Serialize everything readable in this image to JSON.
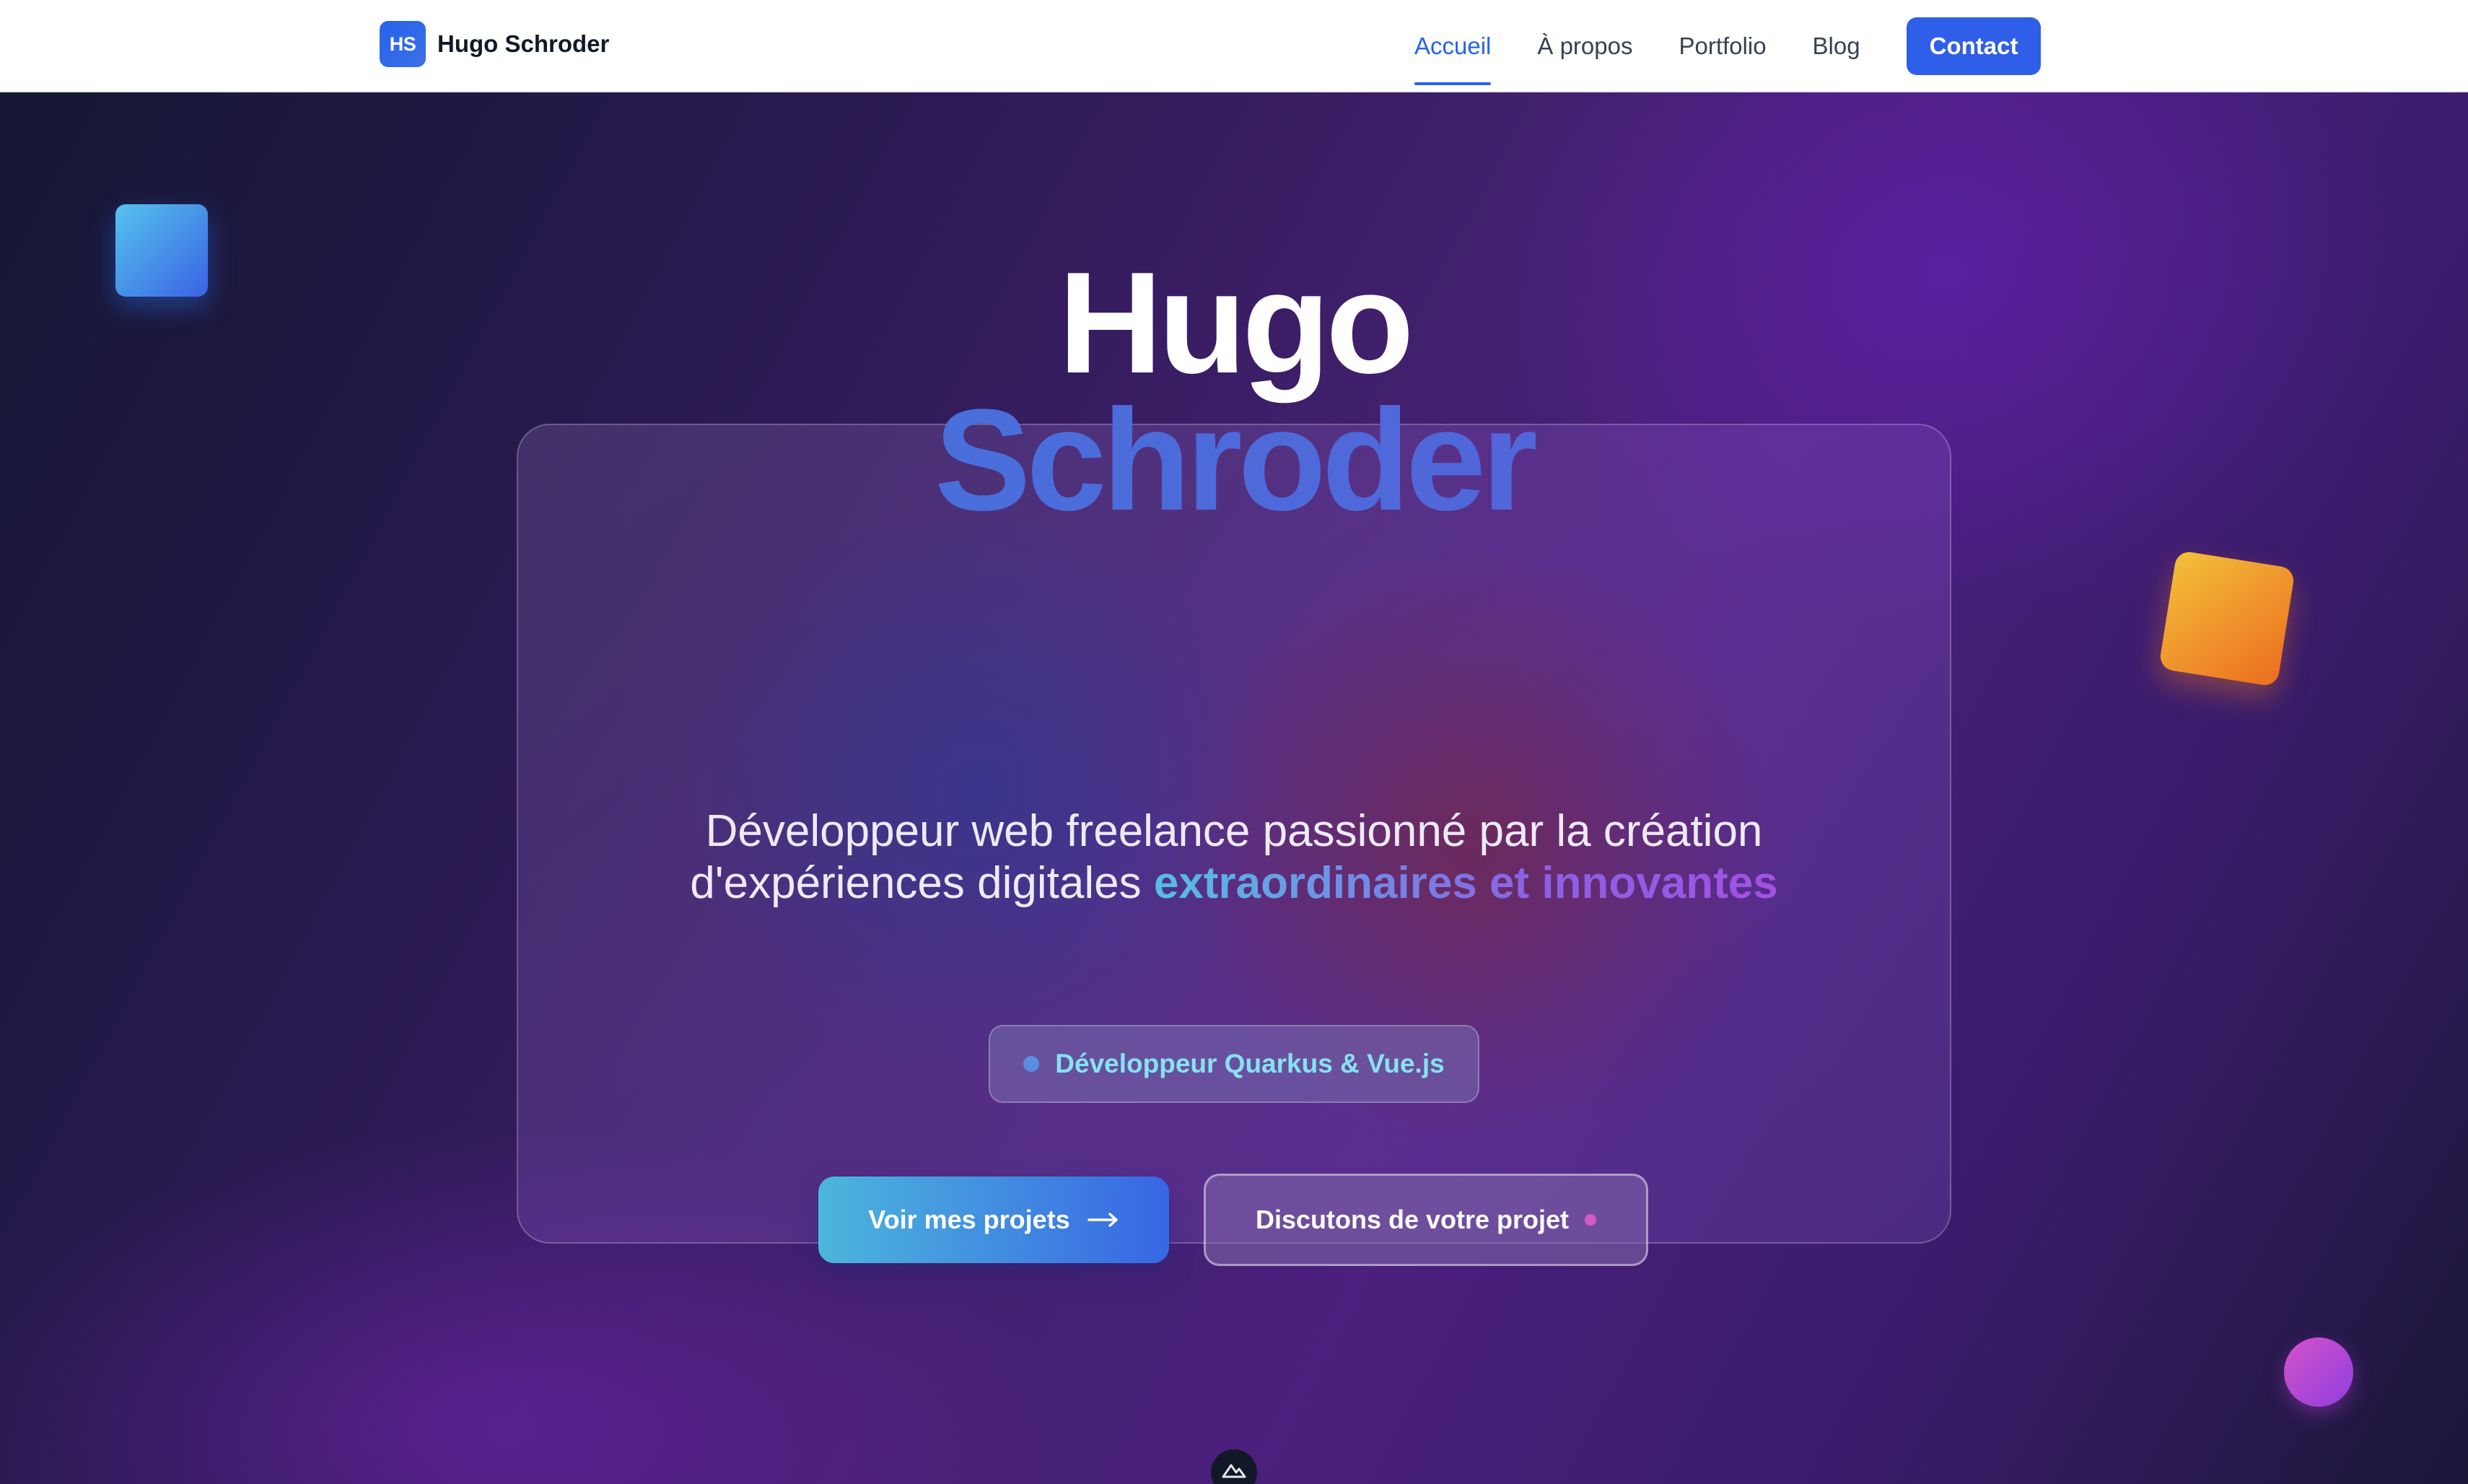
{
  "nav": {
    "brand_initials": "HS",
    "brand_name": "Hugo Schroder",
    "links": [
      {
        "label": "Accueil",
        "active": true
      },
      {
        "label": "À propos",
        "active": false
      },
      {
        "label": "Portfolio",
        "active": false
      },
      {
        "label": "Blog",
        "active": false
      }
    ],
    "cta_label": "Contact"
  },
  "hero": {
    "title_line1": "Hugo",
    "title_line2": "Schroder",
    "subtitle_line1": "Développeur web freelance passionné par la création",
    "subtitle_line2_prefix": "d'expériences digitales ",
    "subtitle_highlight": "extraordinaires et innovantes",
    "badge_label": "Développeur Quarkus & Vue.js",
    "primary_button_label": "Voir mes projets",
    "secondary_button_label": "Discutons de votre projet"
  },
  "colors": {
    "accent": "#2f5ee8",
    "badge_text": "#86e2f2",
    "hero_bg_start": "#151733",
    "hero_bg_mid": "#4a1f7d"
  },
  "icons": {
    "arrow": "arrow-right-icon",
    "scroll": "mountain-logo-icon"
  }
}
